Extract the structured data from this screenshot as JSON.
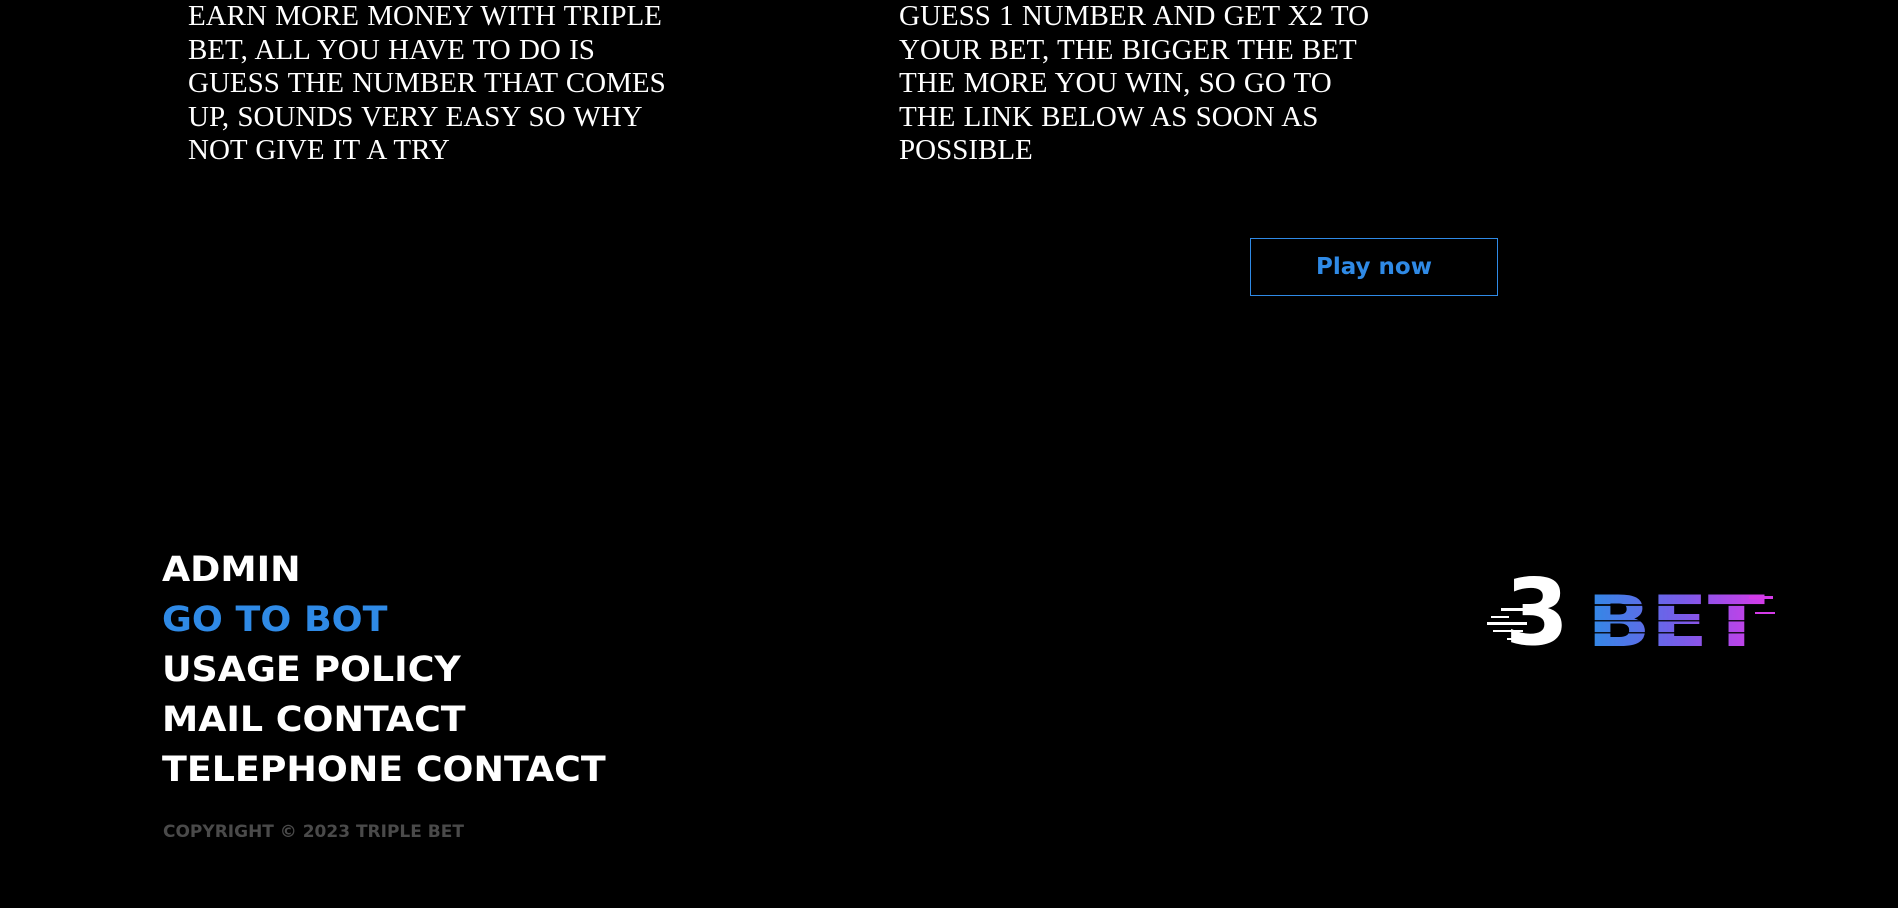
{
  "promo": {
    "left_text": "EARN MORE MONEY WITH TRIPLE BET, ALL YOU HAVE TO DO IS GUESS THE NUMBER THAT COMES UP, SOUNDS VERY EASY SO WHY NOT GIVE IT A TRY",
    "right_text": "GUESS 1 NUMBER AND GET X2 TO YOUR BET, THE BIGGER THE BET THE MORE YOU WIN, SO GO TO THE LINK BELOW AS SOON AS POSSIBLE",
    "play_button_label": "Play now"
  },
  "footer": {
    "nav": [
      {
        "label": "ADMIN",
        "active": false
      },
      {
        "label": "GO TO BOT",
        "active": true
      },
      {
        "label": "USAGE POLICY",
        "active": false
      },
      {
        "label": "MAIL CONTACT",
        "active": false
      },
      {
        "label": "TELEPHONE CONTACT",
        "active": false
      }
    ],
    "copyright": "COPYRIGHT © 2023 TRIPLE BET"
  },
  "logo": {
    "digit": "3",
    "word": "BET"
  },
  "colors": {
    "background": "#000000",
    "accent": "#2f8ae6",
    "text": "#ffffff",
    "muted": "#4a4a4a",
    "logo_gradient_start": "#2f8ae6",
    "logo_gradient_end": "#d43be8"
  }
}
